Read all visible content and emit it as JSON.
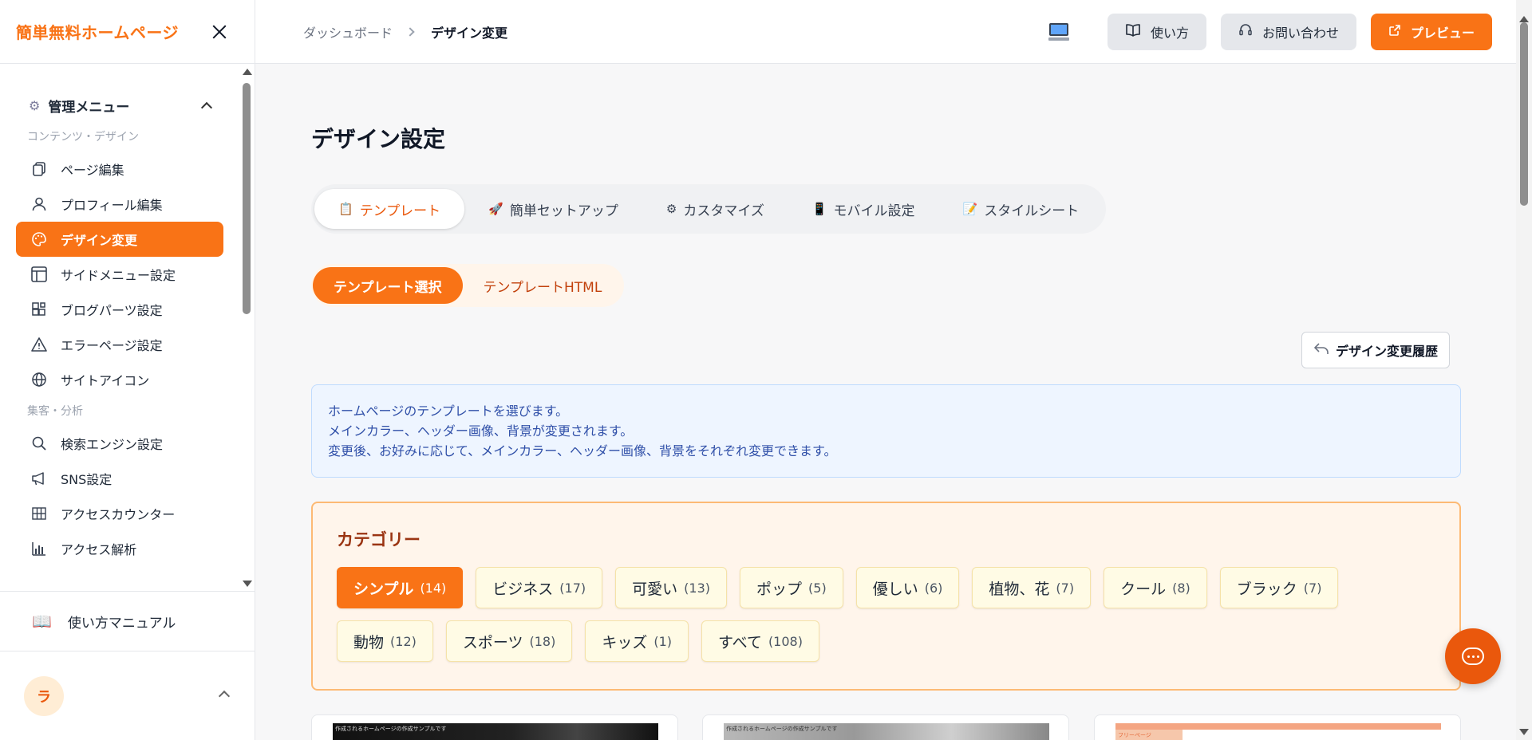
{
  "sidebar": {
    "logo": "簡単無料ホームページ",
    "group_title": "管理メニュー",
    "sections": {
      "content_design": "コンテンツ・デザイン",
      "marketing": "集客・分析"
    },
    "content_items": [
      {
        "label": "ページ編集",
        "icon": "pages-icon"
      },
      {
        "label": "プロフィール編集",
        "icon": "user-icon"
      },
      {
        "label": "デザイン変更",
        "icon": "palette-icon"
      },
      {
        "label": "サイドメニュー設定",
        "icon": "layout-icon"
      },
      {
        "label": "ブログパーツ設定",
        "icon": "blocks-icon"
      },
      {
        "label": "エラーページ設定",
        "icon": "warning-icon"
      },
      {
        "label": "サイトアイコン",
        "icon": "globe-icon"
      }
    ],
    "marketing_items": [
      {
        "label": "検索エンジン設定",
        "icon": "search-icon"
      },
      {
        "label": "SNS設定",
        "icon": "megaphone-icon"
      },
      {
        "label": "アクセスカウンター",
        "icon": "grid-icon"
      },
      {
        "label": "アクセス解析",
        "icon": "chart-icon"
      }
    ],
    "manual": "使い方マニュアル",
    "user_initial": "ラ"
  },
  "topbar": {
    "breadcrumb": [
      "ダッシュボード",
      "デザイン変更"
    ],
    "help_label": "使い方",
    "contact_label": "お問い合わせ",
    "preview_label": "プレビュー"
  },
  "main": {
    "title": "デザイン設定",
    "tabs": [
      {
        "label": "テンプレート",
        "emoji": "📋"
      },
      {
        "label": "簡単セットアップ",
        "emoji": "🚀"
      },
      {
        "label": "カスタマイズ",
        "emoji": "⚙"
      },
      {
        "label": "モバイル設定",
        "emoji": "📱"
      },
      {
        "label": "スタイルシート",
        "emoji": "📝"
      }
    ],
    "subtabs": [
      "テンプレート選択",
      "テンプレートHTML"
    ],
    "history_label": "デザイン変更履歴",
    "info_lines": [
      "ホームページのテンプレートを選びます。",
      "メインカラー、ヘッダー画像、背景が変更されます。",
      "変更後、お好みに応じて、メインカラー、ヘッダー画像、背景をそれぞれ変更できます。"
    ],
    "category_title": "カテゴリー",
    "categories": [
      {
        "label": "シンプル",
        "count": "(14)"
      },
      {
        "label": "ビジネス",
        "count": "(17)"
      },
      {
        "label": "可愛い",
        "count": "(13)"
      },
      {
        "label": "ポップ",
        "count": "(5)"
      },
      {
        "label": "優しい",
        "count": "(6)"
      },
      {
        "label": "植物、花",
        "count": "(7)"
      },
      {
        "label": "クール",
        "count": "(8)"
      },
      {
        "label": "ブラック",
        "count": "(7)"
      },
      {
        "label": "動物",
        "count": "(12)"
      },
      {
        "label": "スポーツ",
        "count": "(18)"
      },
      {
        "label": "キッズ",
        "count": "(1)"
      },
      {
        "label": "すべて",
        "count": "(108)"
      }
    ],
    "template_captions": [
      "作成されるホームページの作成サンプルです",
      "作成されるホームページの作成サンプルです",
      "フリーページ"
    ]
  },
  "colors": {
    "accent": "#f97316",
    "info_bg": "#eef5ff",
    "category_bg": "#fff5eb"
  }
}
